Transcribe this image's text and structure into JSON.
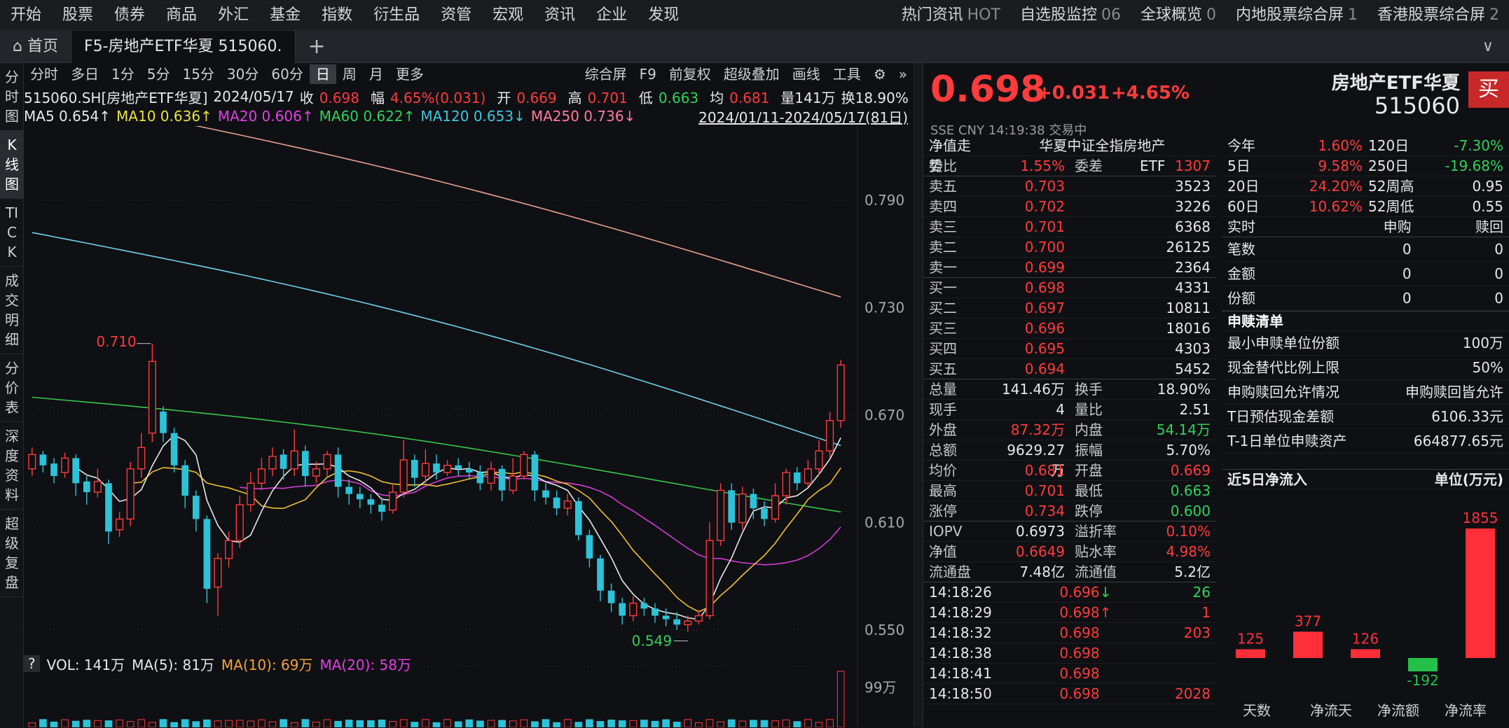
{
  "nav": {
    "items": [
      "开始",
      "股票",
      "债券",
      "商品",
      "外汇",
      "基金",
      "指数",
      "衍生品",
      "资管",
      "宏观",
      "资讯",
      "企业",
      "发现"
    ],
    "right": [
      {
        "label": "热门资讯",
        "sub": "HOT"
      },
      {
        "label": "自选股监控",
        "sub": "06"
      },
      {
        "label": "全球概览",
        "sub": "0"
      },
      {
        "label": "内地股票综合屏",
        "sub": "1"
      },
      {
        "label": "香港股票综合屏",
        "sub": "2"
      }
    ]
  },
  "tabs": {
    "home": "首页",
    "active": "F5-房地产ETF华夏 515060.",
    "plus": "+",
    "menu": "∨"
  },
  "sidebar": [
    "分时图",
    "K线图",
    "TICK",
    "成交明细",
    "分价表",
    "深度资料",
    "超级复盘"
  ],
  "periods": [
    "分时",
    "多日",
    "1分",
    "5分",
    "15分",
    "30分",
    "60分",
    "日",
    "周",
    "月",
    "更多"
  ],
  "period_tools": [
    "综合屏",
    "F9",
    "前复权",
    "超级叠加",
    "画线",
    "工具"
  ],
  "info": {
    "code": "515060.SH[房地产ETF华夏]",
    "date": "2024/05/17",
    "close_l": "收",
    "close": "0.698",
    "amp_l": "幅",
    "amp": "4.65%(0.031)",
    "open_l": "开",
    "open": "0.669",
    "high_l": "高",
    "high": "0.701",
    "low_l": "低",
    "low": "0.663",
    "avg_l": "均",
    "avg": "0.681",
    "vol": "量141万",
    "turn": "换18.90%"
  },
  "ma": {
    "ma5": "MA5 0.654↑",
    "ma10": "MA10 0.636↑",
    "ma20": "MA20 0.606↑",
    "ma60": "MA60 0.622↑",
    "ma120": "MA120 0.653↓",
    "ma250": "MA250 0.736↓",
    "range": "2024/01/11-2024/05/17(81日)"
  },
  "vol_legend": {
    "q": "?",
    "vol": "VOL: 141万",
    "ma5": "MA(5): 81万",
    "ma10": "MA(10): 69万",
    "ma20": "MA(20): 58万",
    "vlabel": "99万"
  },
  "chart_data": {
    "type": "candlestick",
    "yaxis": [
      "0.790",
      "0.730",
      "0.670",
      "0.610",
      "0.550"
    ],
    "annotations": {
      "high": "0.710",
      "low": "0.549"
    },
    "candles": [
      [
        0.64,
        0.648,
        0.652,
        0.636
      ],
      [
        0.648,
        0.642,
        0.65,
        0.638
      ],
      [
        0.643,
        0.636,
        0.646,
        0.632
      ],
      [
        0.638,
        0.646,
        0.649,
        0.635
      ],
      [
        0.646,
        0.632,
        0.648,
        0.625
      ],
      [
        0.633,
        0.627,
        0.636,
        0.62
      ],
      [
        0.627,
        0.633,
        0.64,
        0.624
      ],
      [
        0.632,
        0.605,
        0.634,
        0.598
      ],
      [
        0.606,
        0.612,
        0.616,
        0.602
      ],
      [
        0.612,
        0.64,
        0.644,
        0.608
      ],
      [
        0.64,
        0.652,
        0.66,
        0.635
      ],
      [
        0.66,
        0.7,
        0.71,
        0.655
      ],
      [
        0.672,
        0.66,
        0.675,
        0.655
      ],
      [
        0.66,
        0.642,
        0.663,
        0.638
      ],
      [
        0.642,
        0.625,
        0.645,
        0.618
      ],
      [
        0.625,
        0.612,
        0.628,
        0.605
      ],
      [
        0.612,
        0.573,
        0.614,
        0.565
      ],
      [
        0.574,
        0.59,
        0.593,
        0.558
      ],
      [
        0.59,
        0.6,
        0.605,
        0.585
      ],
      [
        0.6,
        0.62,
        0.625,
        0.596
      ],
      [
        0.62,
        0.632,
        0.638,
        0.616
      ],
      [
        0.632,
        0.64,
        0.646,
        0.628
      ],
      [
        0.64,
        0.647,
        0.652,
        0.636
      ],
      [
        0.648,
        0.64,
        0.651,
        0.634
      ],
      [
        0.64,
        0.65,
        0.662,
        0.636
      ],
      [
        0.65,
        0.636,
        0.653,
        0.63
      ],
      [
        0.636,
        0.64,
        0.644,
        0.632
      ],
      [
        0.64,
        0.648,
        0.65,
        0.636
      ],
      [
        0.648,
        0.63,
        0.652,
        0.624
      ],
      [
        0.63,
        0.626,
        0.634,
        0.62
      ],
      [
        0.626,
        0.623,
        0.63,
        0.618
      ],
      [
        0.623,
        0.62,
        0.626,
        0.615
      ],
      [
        0.62,
        0.616,
        0.624,
        0.611
      ],
      [
        0.617,
        0.627,
        0.631,
        0.615
      ],
      [
        0.627,
        0.645,
        0.656,
        0.624
      ],
      [
        0.645,
        0.635,
        0.648,
        0.63
      ],
      [
        0.636,
        0.643,
        0.651,
        0.632
      ],
      [
        0.643,
        0.638,
        0.648,
        0.634
      ],
      [
        0.638,
        0.642,
        0.645,
        0.636
      ],
      [
        0.642,
        0.64,
        0.646,
        0.636
      ],
      [
        0.64,
        0.638,
        0.644,
        0.634
      ],
      [
        0.638,
        0.632,
        0.642,
        0.628
      ],
      [
        0.632,
        0.64,
        0.644,
        0.628
      ],
      [
        0.64,
        0.628,
        0.642,
        0.622
      ],
      [
        0.628,
        0.636,
        0.646,
        0.626
      ],
      [
        0.636,
        0.648,
        0.65,
        0.634
      ],
      [
        0.648,
        0.628,
        0.65,
        0.622
      ],
      [
        0.628,
        0.624,
        0.632,
        0.62
      ],
      [
        0.624,
        0.618,
        0.628,
        0.614
      ],
      [
        0.618,
        0.622,
        0.626,
        0.614
      ],
      [
        0.622,
        0.603,
        0.624,
        0.6
      ],
      [
        0.603,
        0.59,
        0.606,
        0.585
      ],
      [
        0.59,
        0.572,
        0.592,
        0.566
      ],
      [
        0.572,
        0.565,
        0.576,
        0.56
      ],
      [
        0.565,
        0.558,
        0.568,
        0.553
      ],
      [
        0.558,
        0.565,
        0.569,
        0.555
      ],
      [
        0.565,
        0.562,
        0.568,
        0.558
      ],
      [
        0.562,
        0.558,
        0.565,
        0.554
      ],
      [
        0.558,
        0.556,
        0.562,
        0.552
      ],
      [
        0.556,
        0.553,
        0.56,
        0.55
      ],
      [
        0.553,
        0.555,
        0.558,
        0.549
      ],
      [
        0.555,
        0.558,
        0.561,
        0.553
      ],
      [
        0.558,
        0.6,
        0.61,
        0.556
      ],
      [
        0.6,
        0.628,
        0.632,
        0.597
      ],
      [
        0.628,
        0.61,
        0.632,
        0.606
      ],
      [
        0.61,
        0.626,
        0.63,
        0.606
      ],
      [
        0.626,
        0.618,
        0.629,
        0.612
      ],
      [
        0.618,
        0.612,
        0.622,
        0.608
      ],
      [
        0.612,
        0.625,
        0.632,
        0.61
      ],
      [
        0.625,
        0.638,
        0.64,
        0.62
      ],
      [
        0.638,
        0.632,
        0.641,
        0.628
      ],
      [
        0.632,
        0.64,
        0.645,
        0.63
      ],
      [
        0.64,
        0.65,
        0.656,
        0.636
      ],
      [
        0.65,
        0.667,
        0.672,
        0.646
      ],
      [
        0.667,
        0.698,
        0.701,
        0.663
      ]
    ],
    "ma250": [
      0.85,
      0.736
    ],
    "ma120": [
      0.772,
      0.653
    ]
  },
  "quote": {
    "price": "0.698",
    "change": "+0.031",
    "pct": "+4.65%",
    "name": "房地产ETF华夏",
    "code": "515060",
    "buy": "买",
    "exch": "SSE  CNY  14:19:38  交易中"
  },
  "left_rows": [
    {
      "a": "净值走势",
      "b": "",
      "c": "华夏中证全指房地产ETF",
      "d": "",
      "cls": [
        "white",
        "",
        "white",
        ""
      ]
    },
    {
      "a": "委比",
      "b": "1.55%",
      "c": "委差",
      "d": "1307",
      "cls": [
        "",
        "red",
        "",
        "red"
      ]
    },
    {
      "a": "卖五",
      "b": "0.703",
      "c": "",
      "d": "3523",
      "cls": [
        "",
        "red",
        "",
        "white"
      ]
    },
    {
      "a": "卖四",
      "b": "0.702",
      "c": "",
      "d": "3226",
      "cls": [
        "",
        "red",
        "",
        "white"
      ]
    },
    {
      "a": "卖三",
      "b": "0.701",
      "c": "",
      "d": "6368",
      "cls": [
        "",
        "red",
        "",
        "white"
      ]
    },
    {
      "a": "卖二",
      "b": "0.700",
      "c": "",
      "d": "26125",
      "cls": [
        "",
        "red",
        "",
        "white"
      ]
    },
    {
      "a": "卖一",
      "b": "0.699",
      "c": "",
      "d": "2364",
      "cls": [
        "",
        "red",
        "",
        "white"
      ]
    },
    {
      "a": "买一",
      "b": "0.698",
      "c": "",
      "d": "4331",
      "cls": [
        "",
        "red",
        "",
        "white"
      ]
    },
    {
      "a": "买二",
      "b": "0.697",
      "c": "",
      "d": "10811",
      "cls": [
        "",
        "red",
        "",
        "white"
      ]
    },
    {
      "a": "买三",
      "b": "0.696",
      "c": "",
      "d": "18016",
      "cls": [
        "",
        "red",
        "",
        "white"
      ]
    },
    {
      "a": "买四",
      "b": "0.695",
      "c": "",
      "d": "4303",
      "cls": [
        "",
        "red",
        "",
        "white"
      ]
    },
    {
      "a": "买五",
      "b": "0.694",
      "c": "",
      "d": "5452",
      "cls": [
        "",
        "red",
        "",
        "white"
      ]
    },
    {
      "a": "总量",
      "b": "141.46万",
      "c": "换手",
      "d": "18.90%",
      "cls": [
        "",
        "white",
        "",
        "white"
      ]
    },
    {
      "a": "现手",
      "b": "4",
      "c": "量比",
      "d": "2.51",
      "cls": [
        "",
        "white",
        "",
        "white"
      ]
    },
    {
      "a": "外盘",
      "b": "87.32万",
      "c": "内盘",
      "d": "54.14万",
      "cls": [
        "",
        "red",
        "",
        "green"
      ]
    },
    {
      "a": "总额",
      "b": "9629.27万",
      "c": "振幅",
      "d": "5.70%",
      "cls": [
        "",
        "white",
        "",
        "white"
      ]
    },
    {
      "a": "均价",
      "b": "0.681",
      "c": "开盘",
      "d": "0.669",
      "cls": [
        "",
        "red",
        "",
        "red"
      ]
    },
    {
      "a": "最高",
      "b": "0.701",
      "c": "最低",
      "d": "0.663",
      "cls": [
        "",
        "red",
        "",
        "green"
      ]
    },
    {
      "a": "涨停",
      "b": "0.734",
      "c": "跌停",
      "d": "0.600",
      "cls": [
        "",
        "red",
        "",
        "green"
      ]
    },
    {
      "a": "IOPV",
      "b": "0.6973",
      "c": "溢折率",
      "d": "0.10%",
      "cls": [
        "",
        "white",
        "",
        "red"
      ]
    },
    {
      "a": "净值",
      "b": "0.6649",
      "c": "贴水率",
      "d": "4.98%",
      "cls": [
        "",
        "red",
        "",
        "red"
      ]
    },
    {
      "a": "流通盘",
      "b": "7.48亿",
      "c": "流通值",
      "d": "5.2亿",
      "cls": [
        "",
        "white",
        "",
        "white"
      ]
    }
  ],
  "ticks": [
    {
      "t": "14:18:26",
      "p": "0.696",
      "ar": "↓",
      "v": "26",
      "pc": "red",
      "vc": "green"
    },
    {
      "t": "14:18:29",
      "p": "0.698",
      "ar": "↑",
      "v": "1",
      "pc": "red",
      "vc": "red"
    },
    {
      "t": "14:18:32",
      "p": "0.698",
      "ar": "",
      "v": "203",
      "pc": "red",
      "vc": "red"
    },
    {
      "t": "14:18:38",
      "p": "0.698",
      "ar": "",
      "v": "",
      "pc": "red",
      "vc": "red"
    },
    {
      "t": "14:18:41",
      "p": "0.698",
      "ar": "",
      "v": "",
      "pc": "red",
      "vc": "red"
    },
    {
      "t": "14:18:50",
      "p": "0.698",
      "ar": "",
      "v": "2028",
      "pc": "red",
      "vc": "red"
    }
  ],
  "perf": [
    {
      "a": "今年",
      "b": "1.60%",
      "c": "120日",
      "d": "-7.30%",
      "cb": "red",
      "cd": "green"
    },
    {
      "a": "5日",
      "b": "9.58%",
      "c": "250日",
      "d": "-19.68%",
      "cb": "red",
      "cd": "green"
    },
    {
      "a": "20日",
      "b": "24.20%",
      "c": "52周高",
      "d": "0.95",
      "cb": "red",
      "cd": "white"
    },
    {
      "a": "60日",
      "b": "10.62%",
      "c": "52周低",
      "d": "0.55",
      "cb": "red",
      "cd": "white"
    }
  ],
  "rt_head": {
    "a": "实时",
    "b": "申购",
    "c": "赎回"
  },
  "rt_rows": [
    {
      "a": "笔数",
      "b": "0",
      "c": "0"
    },
    {
      "a": "金额",
      "b": "0",
      "c": "0"
    },
    {
      "a": "份额",
      "b": "0",
      "c": "0"
    }
  ],
  "sub_title": "申赎清单",
  "sub_rows": [
    {
      "a": "最小申赎单位份额",
      "b": "100万"
    },
    {
      "a": "现金替代比例上限",
      "b": "50%"
    },
    {
      "a": "申购赎回允许情况",
      "b": "申购赎回皆允许"
    },
    {
      "a": "T日预估现金差额",
      "b": "6106.33元"
    },
    {
      "a": "T-1日单位申赎资产",
      "b": "664877.65元"
    }
  ],
  "inflow": {
    "title": "近5日净流入",
    "unit": "单位(万元)",
    "values": [
      125,
      377,
      126,
      -192,
      1855
    ],
    "labels": [
      "125",
      "377",
      "126",
      "-192",
      "1855"
    ],
    "xlabels": [
      "天数",
      "净流天",
      "净流额",
      "净流率"
    ]
  }
}
